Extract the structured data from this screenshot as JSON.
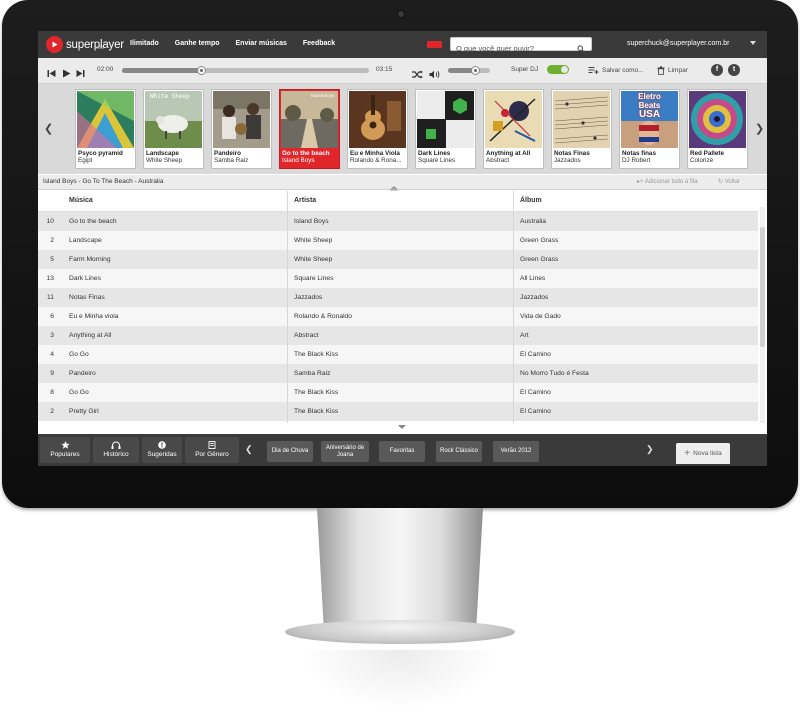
{
  "app": {
    "name": "superplayer",
    "badge": "beta"
  },
  "topnav": [
    "Ilimitado",
    "Ganhe tempo",
    "Enviar músicas",
    "Feedback"
  ],
  "search": {
    "placeholder": "O que você quer ouvir?"
  },
  "user": {
    "email": "superchuck@superplayer.com.br"
  },
  "player": {
    "elapsed": "02:00",
    "duration": "03:15",
    "progress": 0.32,
    "volume": 0.65,
    "superdj_label": "Super DJ",
    "superdj_on": true,
    "save_label": "Salvar como...",
    "clear_label": "Limpar",
    "social": [
      "f",
      "t"
    ]
  },
  "playlists": [
    {
      "title": "Psyco pyramid",
      "subtitle": "Egipt"
    },
    {
      "title": "Landscape",
      "subtitle": "White Sheep"
    },
    {
      "title": "Pandeiro",
      "subtitle": "Samba Raiz"
    },
    {
      "title": "Go to the beach",
      "subtitle": "Island Boys",
      "active": true
    },
    {
      "title": "Eu e Minha Viola",
      "subtitle": "Rolando & Rona..."
    },
    {
      "title": "Dark Lines",
      "subtitle": "Square Lines"
    },
    {
      "title": "Anything at All",
      "subtitle": "Abstract"
    },
    {
      "title": "Notas Finas",
      "subtitle": "Jazzados"
    },
    {
      "title": "Notas finas",
      "subtitle": "DJ Robert"
    },
    {
      "title": "Red Pallete",
      "subtitle": "Colorize"
    }
  ],
  "art_text": {
    "sheep": "White Sheep",
    "beach": "Island Boys",
    "eletro": [
      "Eletro",
      "Beats",
      "USA"
    ]
  },
  "nowplaying": {
    "text": "Island Boys - Go To The Beach - Australia",
    "add_all": "Adicionar tudo à fila",
    "back": "Voltar"
  },
  "table": {
    "columns": [
      "Música",
      "Artista",
      "Álbum"
    ],
    "rows": [
      {
        "n": "10",
        "song": "Go to the beach",
        "artist": "Island Boys",
        "album": "Australia"
      },
      {
        "n": "2",
        "song": "Landscape",
        "artist": "White Sheep",
        "album": "Green Grass"
      },
      {
        "n": "5",
        "song": "Farm Morning",
        "artist": "White Sheep",
        "album": "Green Grass"
      },
      {
        "n": "13",
        "song": "Dark Lines",
        "artist": "Square Lines",
        "album": "All Lines"
      },
      {
        "n": "11",
        "song": "Notas Finas",
        "artist": "Jazzados",
        "album": "Jazzados"
      },
      {
        "n": "6",
        "song": "Eu e Minha viola",
        "artist": "Rolando & Ronaldo",
        "album": "Vida de Gado"
      },
      {
        "n": "3",
        "song": "Anything at All",
        "artist": "Abstract",
        "album": "Art"
      },
      {
        "n": "4",
        "song": "Go Go",
        "artist": "The Black Kiss",
        "album": "El Camino"
      },
      {
        "n": "9",
        "song": "Pandeiro",
        "artist": "Samba Raiz",
        "album": "No Morro Tudo é Festa"
      },
      {
        "n": "8",
        "song": "Go Go",
        "artist": "The Black Kiss",
        "album": "El Camino"
      },
      {
        "n": "2",
        "song": "Pretty Girl",
        "artist": "The Black Kiss",
        "album": "El Camino"
      }
    ]
  },
  "bottom": {
    "nav": [
      "Populares",
      "Histórico",
      "Sugeridas",
      "Por Gênero"
    ],
    "lists": [
      "Dia de Chuva",
      "Aniversário de Joana",
      "Favoritas",
      "Rock Clássico",
      "Verão 2012"
    ],
    "new_list": "Nova lista"
  },
  "colors": {
    "accent": "#e0262b",
    "toggle_on": "#6fae2e",
    "bar": "#3b3a3a"
  }
}
